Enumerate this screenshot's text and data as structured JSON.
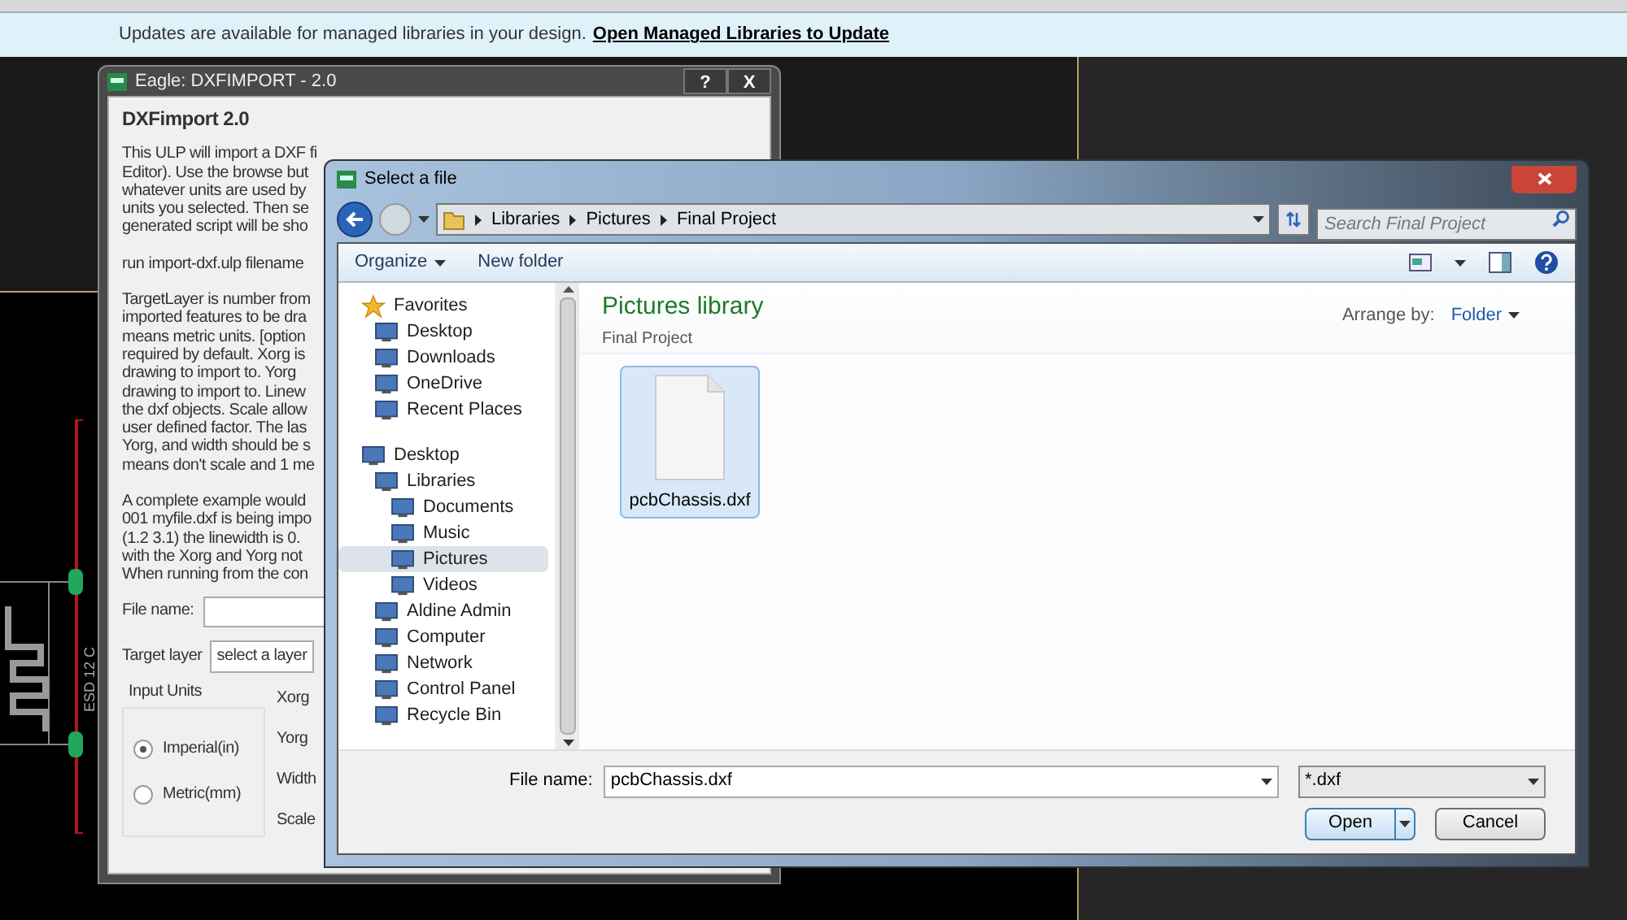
{
  "notification": {
    "text": "Updates are available for managed libraries in your design.",
    "link": "Open Managed Libraries to Update"
  },
  "pcb": {
    "label": "ESD 12 C"
  },
  "ulp_dialog": {
    "title": "Eagle: DXFIMPORT - 2.0",
    "buttons": [
      "?",
      "X"
    ],
    "heading": "DXFimport 2.0",
    "paragraphs": [
      [
        "This ULP will import a DXF fi",
        "Editor). Use the browse but",
        "whatever units are used by",
        "units you selected. Then se",
        "generated script will be sho"
      ],
      [
        "run import-dxf.ulp filename"
      ],
      [
        "TargetLayer is number from",
        "imported features to be dra",
        "means metric units. [option",
        "required by default. Xorg is",
        "drawing to import to. Yorg",
        "drawing to import to. Linew",
        "the dxf objects. Scale allow",
        "user defined factor. The las",
        "Yorg, and width should be s",
        "means don't scale and 1 me"
      ],
      [
        "A complete example would",
        "001 myfile.dxf is being impo",
        "(1.2 3.1) the linewidth is 0.",
        "with the Xorg and Yorg not",
        "When running from the con"
      ]
    ],
    "file_name_label": "File name:",
    "target_layer_label": "Target layer",
    "target_layer_value": "select a layer",
    "units_group": "Input Units",
    "units": [
      {
        "label": "Imperial(in)",
        "selected": true
      },
      {
        "label": "Metric(mm)",
        "selected": false
      }
    ],
    "params": [
      "Xorg",
      "Yorg",
      "Width",
      "Scale"
    ]
  },
  "file_dialog": {
    "title": "Select a file",
    "breadcrumb": [
      "Libraries",
      "Pictures",
      "Final Project"
    ],
    "search": {
      "placeholder": "Search Final Project"
    },
    "toolbar": [
      "Organize",
      "New folder"
    ],
    "nav": [
      {
        "label": "Favorites",
        "selected": false,
        "children": [
          {
            "label": "Desktop",
            "selected": false
          },
          {
            "label": "Downloads",
            "selected": false
          },
          {
            "label": "OneDrive",
            "selected": false
          },
          {
            "label": "Recent Places",
            "selected": false
          }
        ]
      },
      {
        "label": "Desktop",
        "selected": false,
        "children": [
          {
            "label": "Libraries",
            "selected": false,
            "children": [
              {
                "label": "Documents",
                "selected": false
              },
              {
                "label": "Music",
                "selected": false
              },
              {
                "label": "Pictures",
                "selected": true
              },
              {
                "label": "Videos",
                "selected": false
              }
            ]
          },
          {
            "label": "Aldine Admin",
            "selected": false
          },
          {
            "label": "Computer",
            "selected": false
          },
          {
            "label": "Network",
            "selected": false
          },
          {
            "label": "Control Panel",
            "selected": false
          },
          {
            "label": "Recycle Bin",
            "selected": false
          }
        ]
      }
    ],
    "library_title": "Pictures library",
    "library_subtitle": "Final Project",
    "arrange_label": "Arrange by:",
    "arrange_value": "Folder",
    "files": [
      {
        "name": "pcbChassis.dxf",
        "selected": true
      }
    ],
    "file_name_label": "File name:",
    "file_name_value": "pcbChassis.dxf",
    "filter": "*.dxf",
    "open": "Open",
    "cancel": "Cancel"
  }
}
